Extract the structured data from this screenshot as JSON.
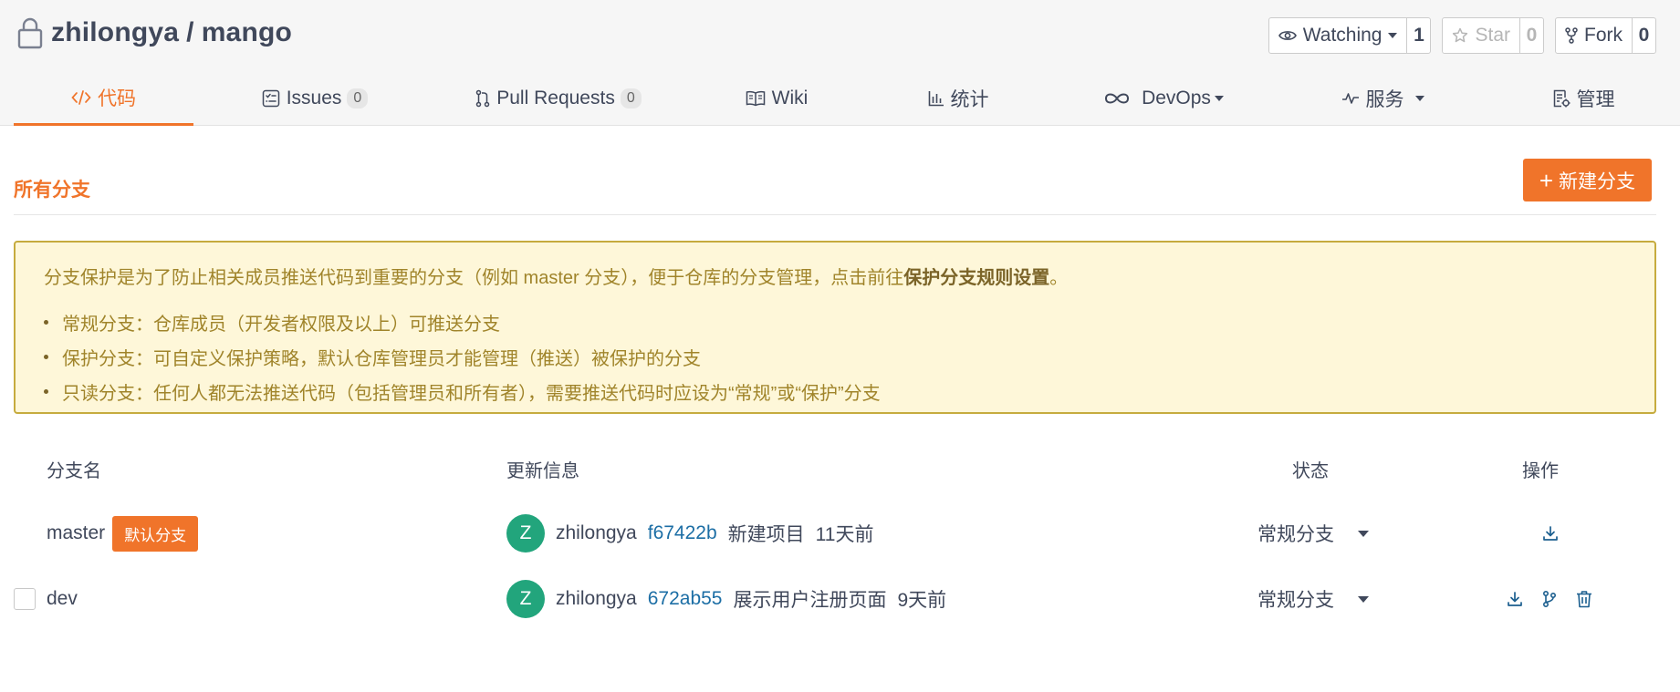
{
  "repo": {
    "owner": "zhilongya",
    "separator": "/",
    "name": "mango"
  },
  "actions": {
    "watch_label": "Watching",
    "watch_count": "1",
    "star_label": "Star",
    "star_count": "0",
    "fork_label": "Fork",
    "fork_count": "0"
  },
  "tabs": [
    {
      "label": "代码",
      "icon": "code-icon"
    },
    {
      "label": "Issues",
      "icon": "issues-icon",
      "badge": "0"
    },
    {
      "label": "Pull Requests",
      "icon": "pull-request-icon",
      "badge": "0"
    },
    {
      "label": "Wiki",
      "icon": "book-icon"
    },
    {
      "label": "统计",
      "icon": "bar-chart-icon"
    },
    {
      "label": "DevOps",
      "icon": "infinity-icon"
    },
    {
      "label": "服务",
      "icon": "pulse-icon"
    },
    {
      "label": "管理",
      "icon": "settings-doc-icon"
    }
  ],
  "section": {
    "title": "所有分支",
    "new_branch_label": "新建分支"
  },
  "notice": {
    "intro": "分支保护是为了防止相关成员推送代码到重要的分支（例如 master 分支），便于仓库的分支管理，点击前往",
    "link": "保护分支规则设置",
    "intro_end": "。",
    "items": [
      "常规分支：仓库成员（开发者权限及以上）可推送分支",
      "保护分支：可自定义保护策略，默认仓库管理员才能管理（推送）被保护的分支",
      "只读分支：任何人都无法推送代码（包括管理员和所有者），需要推送代码时应设为“常规”或“保护”分支"
    ]
  },
  "table": {
    "headers": {
      "name": "分支名",
      "update": "更新信息",
      "status": "状态",
      "ops": "操作"
    },
    "rows": [
      {
        "name": "master",
        "tag": "默认分支",
        "avatar": "Z",
        "user": "zhilongya",
        "sha": "f67422b",
        "message": "新建项目",
        "time": "11天前",
        "status": "常规分支"
      },
      {
        "name": "dev",
        "avatar": "Z",
        "user": "zhilongya",
        "sha": "672ab55",
        "message": "展示用户注册页面",
        "time": "9天前",
        "status": "常规分支"
      }
    ]
  },
  "colors": {
    "accent": "#f0742a",
    "avatar": "#22a57c",
    "sha_link": "#1c6ea5",
    "notice_bg": "#fef7d9",
    "notice_border": "#c6ab3e"
  }
}
